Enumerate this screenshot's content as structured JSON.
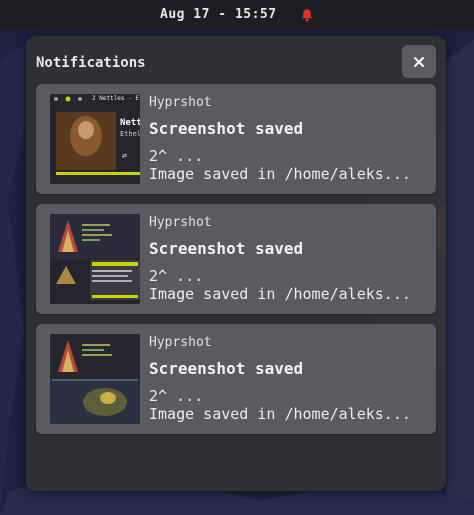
{
  "topbar": {
    "clock": "Aug 17 - 15:57",
    "bell_icon": "bell-icon",
    "bell_color": "#e0302a"
  },
  "panel": {
    "title": "Notifications",
    "close_icon": "close-icon"
  },
  "notifications": [
    {
      "app": "Hyprshot",
      "summary": "Screenshot saved",
      "body_line1": "2^ ...",
      "body_line2": "Image saved in /home/aleks...",
      "thumb": {
        "title": "2 Nettles - E",
        "track": "Nett",
        "artist": "Ethel"
      }
    },
    {
      "app": "Hyprshot",
      "summary": "Screenshot saved",
      "body_line1": "2^ ...",
      "body_line2": "Image saved in /home/aleks..."
    },
    {
      "app": "Hyprshot",
      "summary": "Screenshot saved",
      "body_line1": "2^ ...",
      "body_line2": "Image saved in /home/aleks..."
    }
  ],
  "colors": {
    "panel_bg": "#303136",
    "card_bg": "#5a5b61",
    "accent_yellow": "#c8d400"
  }
}
